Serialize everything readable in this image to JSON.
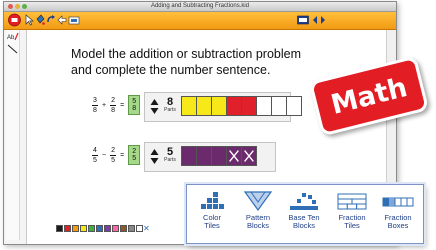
{
  "window": {
    "title": "Adding and Subtracting Fractions.kid"
  },
  "main": {
    "instruction_line1": "Model the addition or subtraction problem",
    "instruction_line2": "and complete the number sentence."
  },
  "problems": [
    {
      "a_num": "3",
      "a_den": "8",
      "op": "+",
      "b_num": "2",
      "b_den": "8",
      "eq": "=",
      "ans_num": "5",
      "ans_den": "8",
      "count": "8",
      "count_label": "Parts",
      "cells": [
        "yellow",
        "yellow",
        "yellow",
        "red",
        "red",
        "empty",
        "empty",
        "empty"
      ]
    },
    {
      "a_num": "4",
      "a_den": "5",
      "op": "−",
      "b_num": "2",
      "b_den": "5",
      "eq": "=",
      "ans_num": "2",
      "ans_den": "5",
      "count": "5",
      "count_label": "Parts",
      "cells": [
        "purple",
        "purple",
        "purple",
        "purple-x",
        "purple-x"
      ]
    }
  ],
  "badge": {
    "text": "Math"
  },
  "tiles": [
    {
      "line1": "Color",
      "line2": "Tiles",
      "icon": "color-tiles-icon"
    },
    {
      "line1": "Pattern",
      "line2": "Blocks",
      "icon": "pattern-blocks-icon"
    },
    {
      "line1": "Base Ten",
      "line2": "Blocks",
      "icon": "base-ten-blocks-icon"
    },
    {
      "line1": "Fraction",
      "line2": "Tiles",
      "icon": "fraction-tiles-icon"
    },
    {
      "line1": "Fraction",
      "line2": "Boxes",
      "icon": "fraction-boxes-icon"
    }
  ],
  "colors": {
    "yellow": "#f7e81a",
    "red": "#e0202a",
    "purple": "#6b2a6b",
    "answer_green": "#a6d889",
    "toolbar_orange": "#f5a623",
    "badge_red": "#e21d24",
    "tile_blue": "#2f6fb6"
  },
  "palette": [
    "#1a1a1a",
    "#e0202a",
    "#f39c12",
    "#f7e81a",
    "#3fae49",
    "#2f6fb6",
    "#7b3fa0",
    "#ff66aa",
    "#8b5a2b",
    "#888888",
    "#ffffff"
  ]
}
